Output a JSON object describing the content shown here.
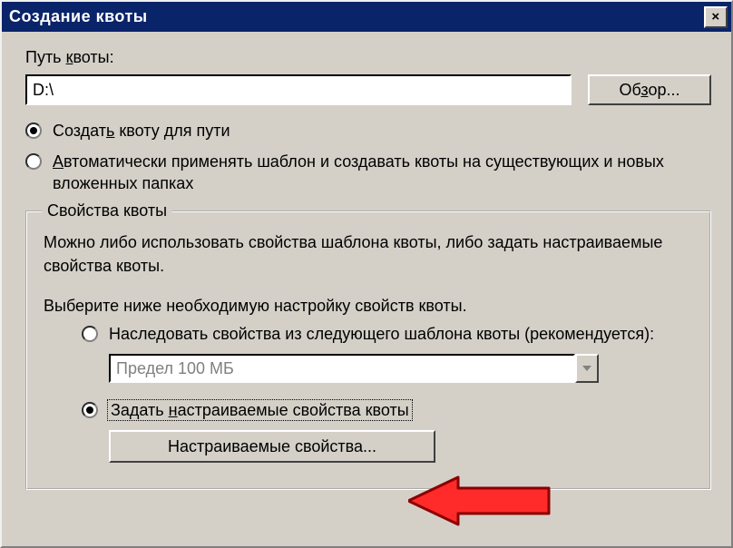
{
  "window": {
    "title": "Создание квоты",
    "close_icon": "×"
  },
  "path": {
    "label_pre": "Путь ",
    "label_u": "к",
    "label_post": "воты:",
    "value": "D:\\",
    "browse_pre": "Об",
    "browse_u": "з",
    "browse_post": "ор..."
  },
  "radios": {
    "create_pre": "Создат",
    "create_u": "ь",
    "create_post": " квоту для пути",
    "auto_u": "А",
    "auto_post": "втоматически применять шаблон и создавать квоты на существующих и новых вложенных папках"
  },
  "group": {
    "legend": "Свойства квоты",
    "info": "Можно либо использовать свойства шаблона квоты, либо задать настраиваемые свойства квоты.",
    "prompt": "Выберите ниже необходимую настройку свойств квоты.",
    "inherit": "Наследовать свойства из следующего шаблона квоты (рекомендуется):",
    "combo_value": "Предел 100 МБ",
    "custom_pre": "Задать ",
    "custom_u": "н",
    "custom_post": "астраиваемые свойства квоты",
    "custom_btn": "Настраиваемые свойства..."
  }
}
